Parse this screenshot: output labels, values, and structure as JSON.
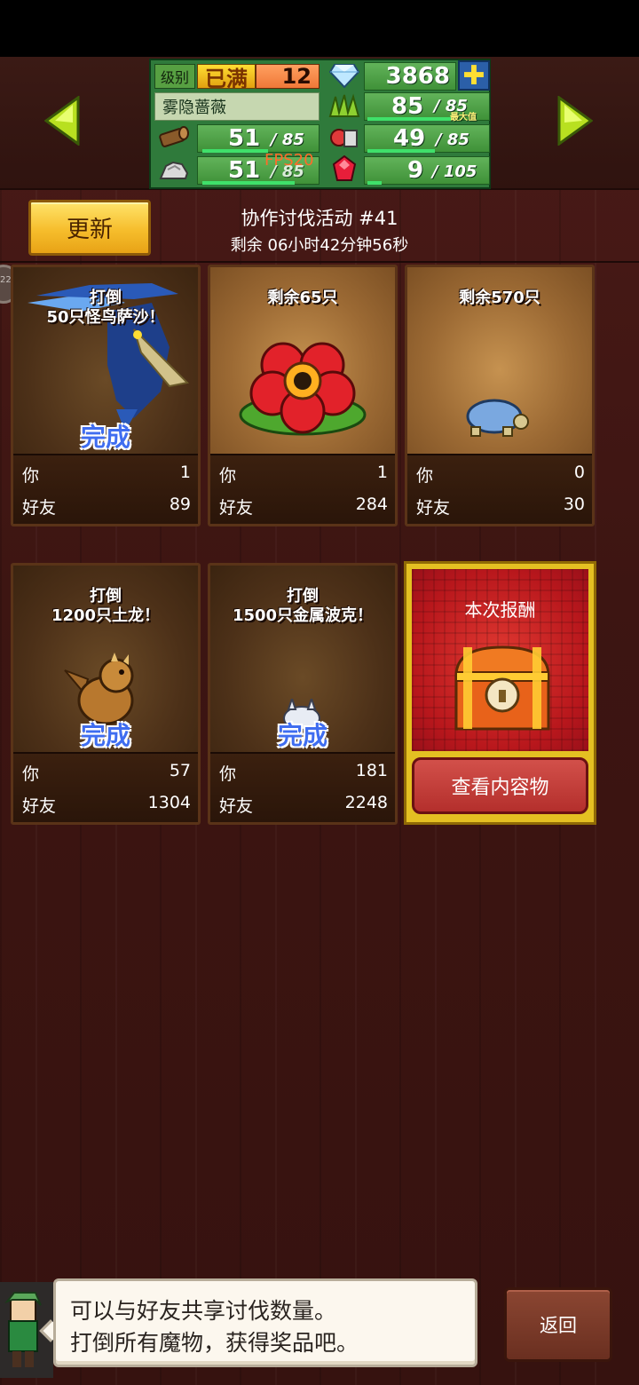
{
  "stats": {
    "level_label": "级别",
    "level_status": "已满",
    "level": "12",
    "gems": "3868",
    "plus_symbol": "✚",
    "character_name": "雾隐蔷薇",
    "wood_current": "51",
    "wood_max": "/ 85",
    "stone_current": "51",
    "stone_max": "/ 85",
    "grass_current": "85",
    "grass_max": "/ 85",
    "grass_note": "最大值",
    "food_current": "49",
    "food_max": "/ 85",
    "ruby_current": "9",
    "ruby_max": "/ 105",
    "fps_overlay": "FPS20"
  },
  "header": {
    "refresh_label": "更新",
    "event_title": "协作讨伐活动 #41",
    "time_remaining": "剩余 06小时42分钟56秒",
    "side_badge": "22"
  },
  "cards": [
    {
      "title_line1": "打倒",
      "title_line2": "50只怪鸟萨沙！",
      "status": "完成",
      "you_label": "你",
      "you_value": "1",
      "friends_label": "好友",
      "friends_value": "89",
      "monster_icon": "blue-bird-monster-icon"
    },
    {
      "title_line1": "",
      "title_line2": "剩余65只",
      "status": "",
      "you_label": "你",
      "you_value": "1",
      "friends_label": "好友",
      "friends_value": "284",
      "monster_icon": "red-flower-monster-icon"
    },
    {
      "title_line1": "",
      "title_line2": "剩余570只",
      "status": "",
      "you_label": "你",
      "you_value": "0",
      "friends_label": "好友",
      "friends_value": "30",
      "monster_icon": "blue-turtle-monster-icon"
    },
    {
      "title_line1": "打倒",
      "title_line2": "1200只土龙！",
      "status": "完成",
      "you_label": "你",
      "you_value": "57",
      "friends_label": "好友",
      "friends_value": "1304",
      "monster_icon": "earth-dragon-monster-icon"
    },
    {
      "title_line1": "打倒",
      "title_line2": "1500只金属波克！",
      "status": "完成",
      "you_label": "你",
      "you_value": "181",
      "friends_label": "好友",
      "friends_value": "2248",
      "monster_icon": "metal-poko-monster-icon"
    }
  ],
  "reward": {
    "title": "本次报酬",
    "view_button": "查看内容物",
    "chest_icon": "treasure-chest-icon"
  },
  "dialog": {
    "line1": "可以与好友共享讨伐数量。",
    "line2": "打倒所有魔物，获得奖品吧。"
  },
  "back_label": "返回",
  "colors": {
    "accent_yellow": "#f6bd2c",
    "panel_green": "#2f7a3b",
    "complete_blue": "#3f6df0",
    "reward_red": "#b8171c",
    "background": "#3d1512"
  }
}
